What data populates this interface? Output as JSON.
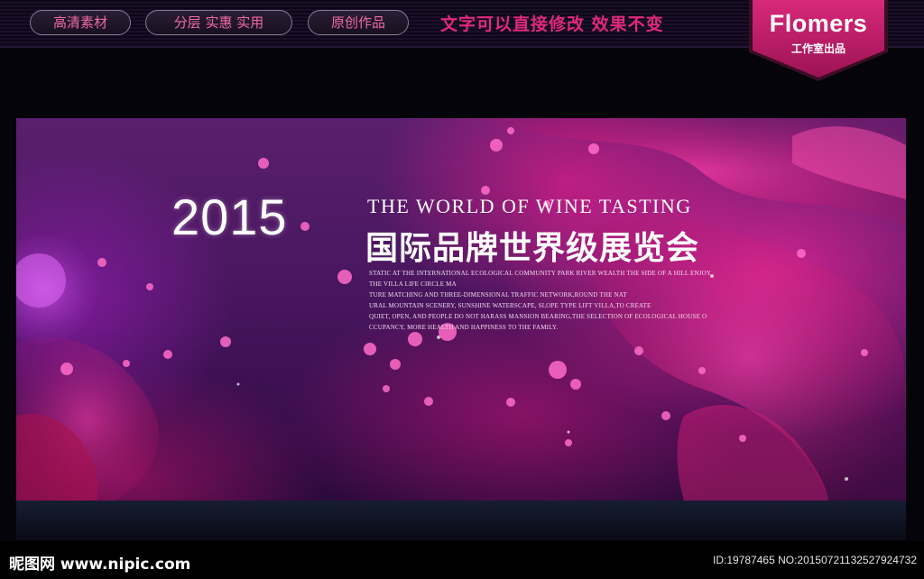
{
  "topbar": {
    "pills": [
      "高清素材",
      "分层 实惠 实用",
      "原创作品"
    ],
    "slogan": "文字可以直接修改  效果不变",
    "brand_name": "Flomers",
    "brand_sub": "工作室出品"
  },
  "banner": {
    "year": "2015",
    "title_en": "THE WORLD OF WINE TASTING",
    "title_cn": "国际品牌世界级展览会",
    "description": [
      "STATIC AT THE INTERNATIONAL ECOLOGICAL COMMUNITY PARK RIVER WEALTH THE SIDE OF A HILL ENJOY",
      "THE VILLA LIFE CIRCLE MA",
      "TURE MATCHING AND THREE-DIMENSIONAL TRAFFIC NETWORK,ROUND THE NAT",
      "URAL MOUNTAIN SCENERY, SUNSHINE WATERSCAPE, SLOPE TYPE LIFT VILLA,TO CREATE",
      "QUIET, OPEN, AND PEOPLE DO NOT HARASS MANSION BEARING,THE SELECTION OF ECOLOGICAL HOUSE O",
      "CCUPANCY, MORE HEALTH AND HAPPINESS TO THE FAMILY."
    ]
  },
  "watermark": {
    "logo": "昵图网 www.nipic.com",
    "id": "ID:19787465 NO:20150721132527924732"
  },
  "colors": {
    "accent": "#e0297c",
    "brand_bg": "#c21d6a",
    "banner_base": "#4a1760"
  }
}
